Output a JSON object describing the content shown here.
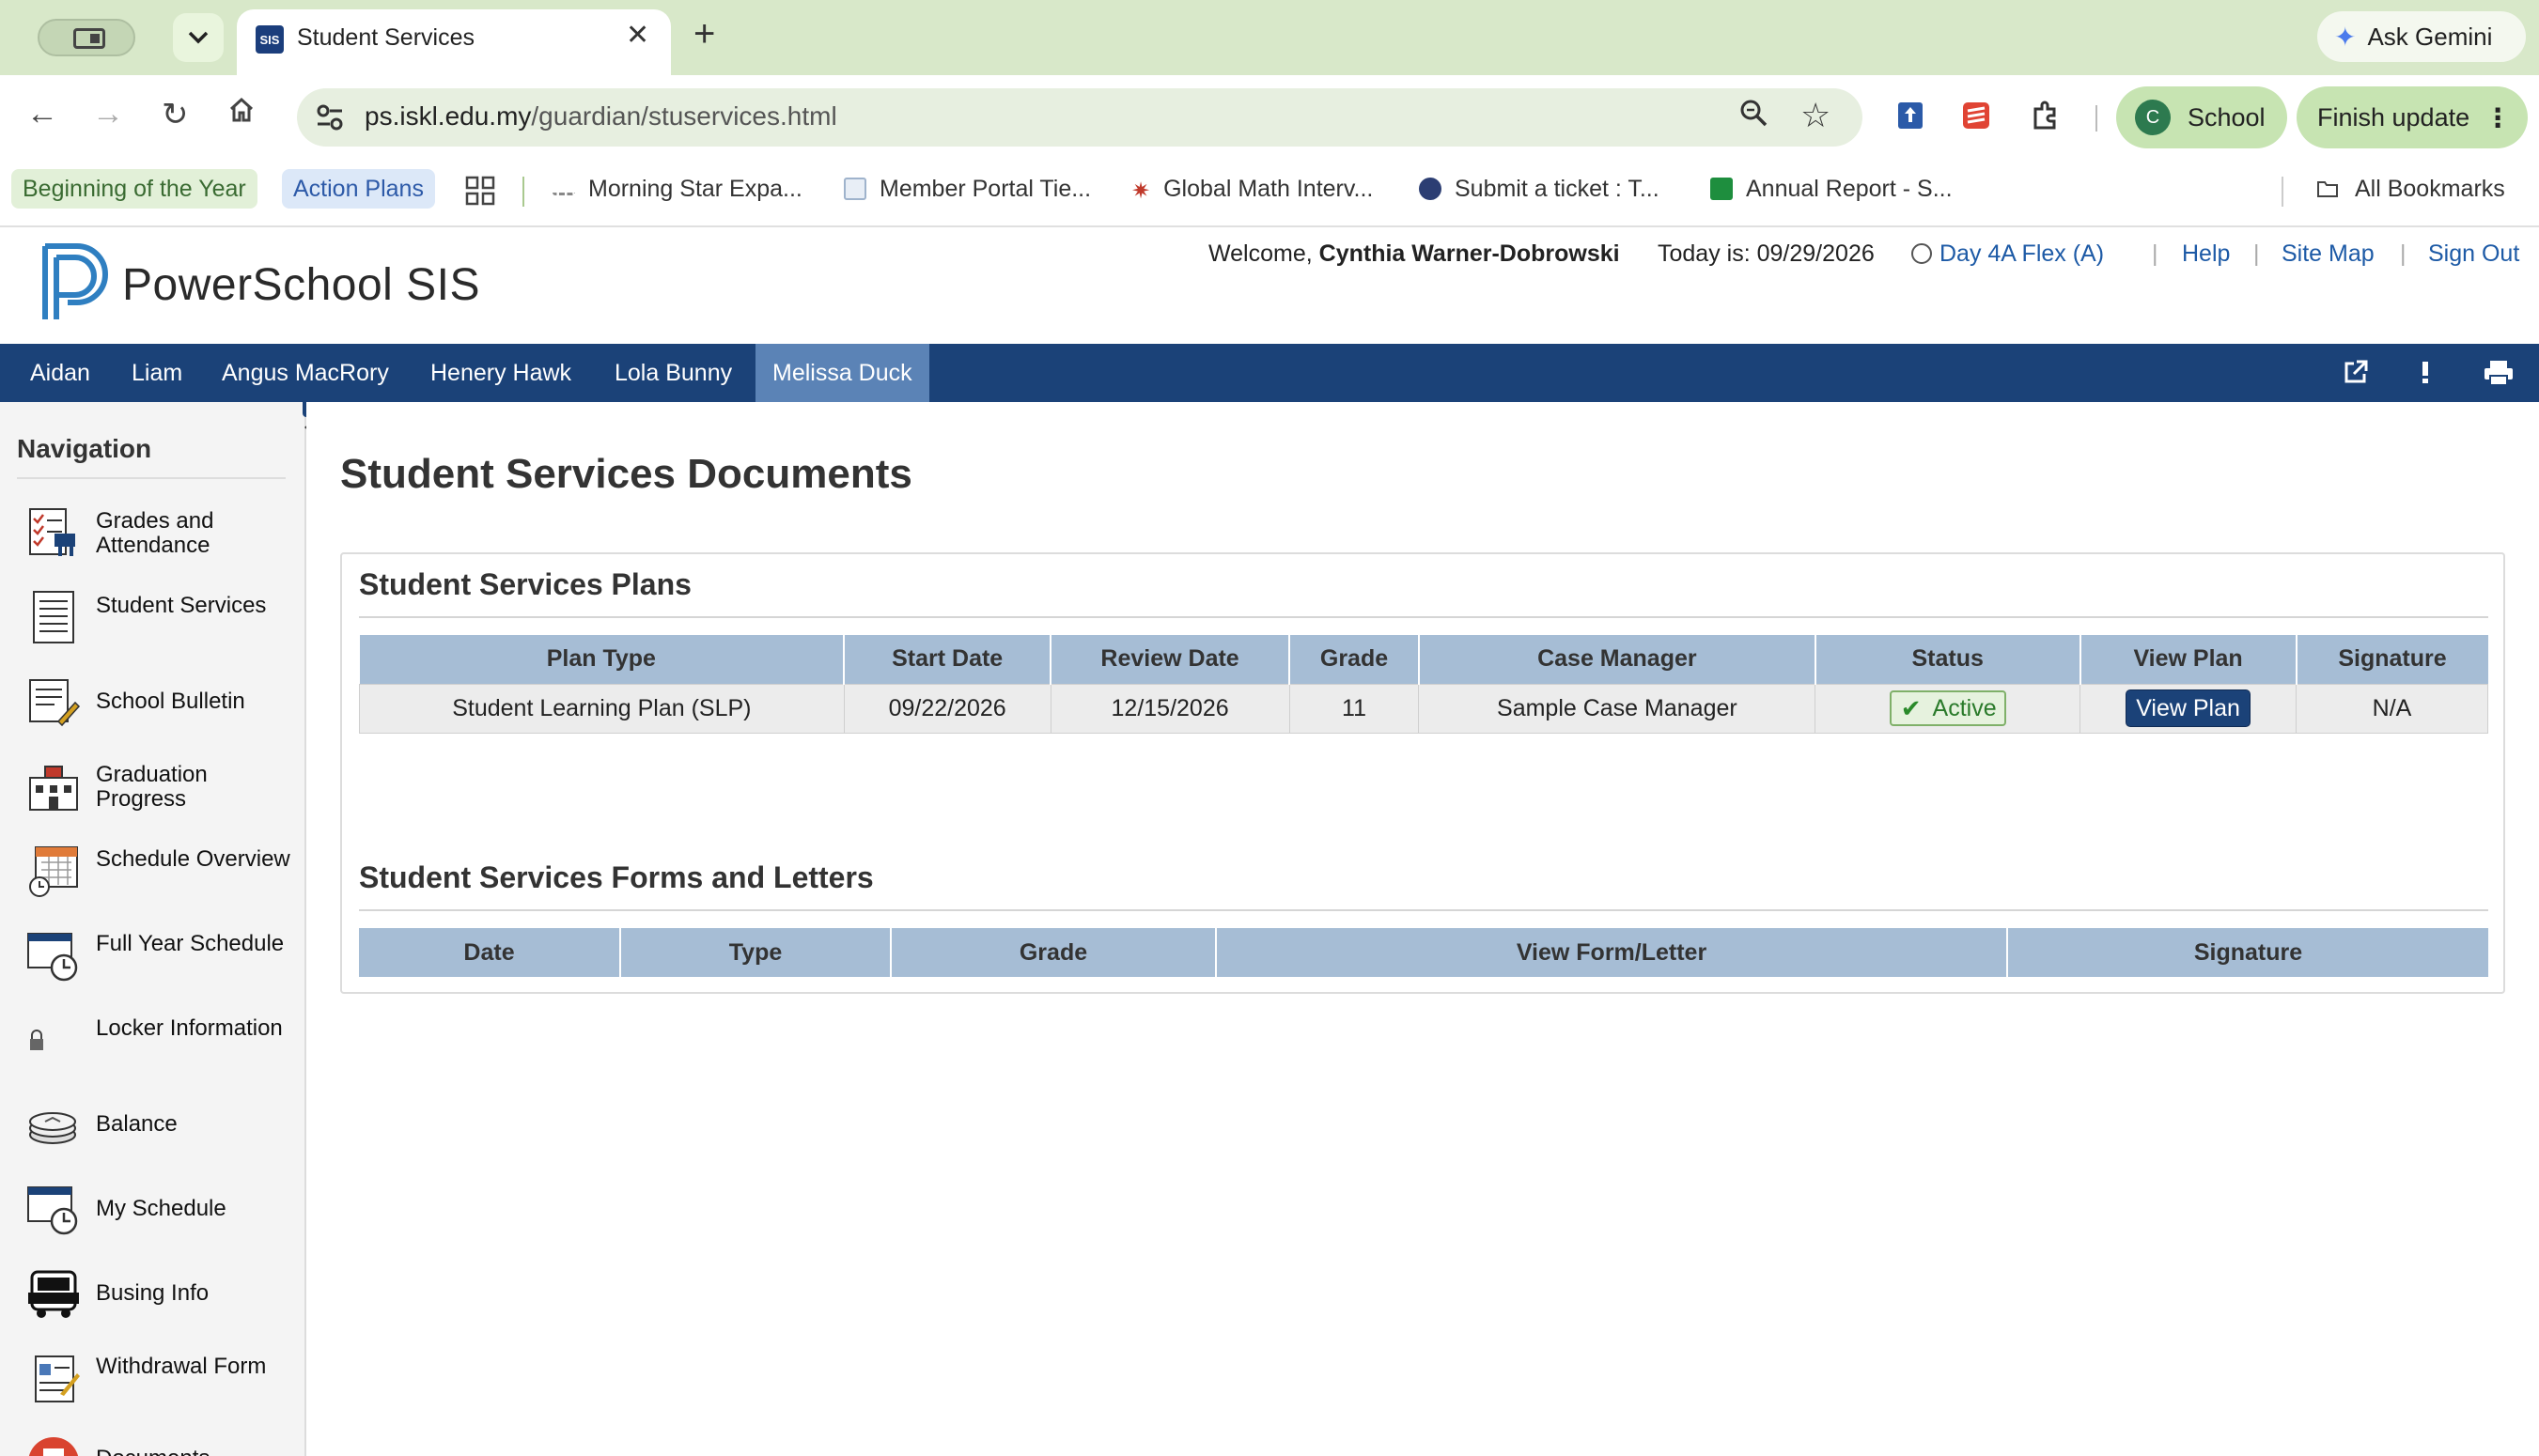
{
  "browser": {
    "tab_title": "Student Services",
    "tab_favicon": "SIS",
    "gemini_label": "Ask Gemini",
    "url_host": "ps.iskl.edu.my",
    "url_path": "/guardian/stuservices.html",
    "profile_initial": "C",
    "profile_label": "School",
    "finish_update_label": "Finish update",
    "bookmarks": [
      {
        "label": "Beginning of the Year"
      },
      {
        "label": "Action Plans"
      },
      {
        "label": "Morning Star Expa..."
      },
      {
        "label": "Member Portal Tie..."
      },
      {
        "label": "Global Math Interv..."
      },
      {
        "label": "Submit a ticket : T..."
      },
      {
        "label": "Annual Report - S..."
      }
    ],
    "all_bookmarks_label": "All Bookmarks"
  },
  "header": {
    "logo_text": "PowerSchool SIS",
    "welcome_prefix": "Welcome,",
    "user_name": "Cynthia Warner-Dobrowski",
    "today_label": "Today is:",
    "today_date": "09/29/2026",
    "day_label": "Day 4A Flex (A)",
    "help": "Help",
    "site_map": "Site Map",
    "sign_out": "Sign Out"
  },
  "students": [
    {
      "name": "Aidan"
    },
    {
      "name": "Liam"
    },
    {
      "name": "Angus MacRory"
    },
    {
      "name": "Henery Hawk"
    },
    {
      "name": "Lola Bunny"
    },
    {
      "name": "Melissa Duck"
    }
  ],
  "nav": {
    "title": "Navigation",
    "items": [
      {
        "label": "Grades and Attendance"
      },
      {
        "label": "Student Services"
      },
      {
        "label": "School Bulletin"
      },
      {
        "label": "Graduation Progress"
      },
      {
        "label": "Schedule Overview"
      },
      {
        "label": "Full Year Schedule"
      },
      {
        "label": "Locker Information"
      },
      {
        "label": "Balance"
      },
      {
        "label": "My Schedule"
      },
      {
        "label": "Busing Info"
      },
      {
        "label": "Withdrawal Form"
      },
      {
        "label": "Documents"
      }
    ]
  },
  "main": {
    "title": "Student Services Documents",
    "plans": {
      "heading": "Student Services Plans",
      "columns": [
        "Plan Type",
        "Start Date",
        "Review Date",
        "Grade",
        "Case Manager",
        "Status",
        "View Plan",
        "Signature"
      ],
      "rows": [
        {
          "plan_type": "Student Learning Plan (SLP)",
          "start_date": "09/22/2026",
          "review_date": "12/15/2026",
          "grade": "11",
          "case_manager": "Sample Case Manager",
          "status": "Active",
          "view_plan": "View Plan",
          "signature": "N/A"
        }
      ]
    },
    "forms": {
      "heading": "Student Services Forms and Letters",
      "columns": [
        "Date",
        "Type",
        "Grade",
        "View Form/Letter",
        "Signature"
      ]
    }
  },
  "colors": {
    "student_bar": "#1b4278",
    "selected_student": "#5b83b6",
    "table_header": "#a6bdd5",
    "chrome_green": "#d8e8c9"
  }
}
